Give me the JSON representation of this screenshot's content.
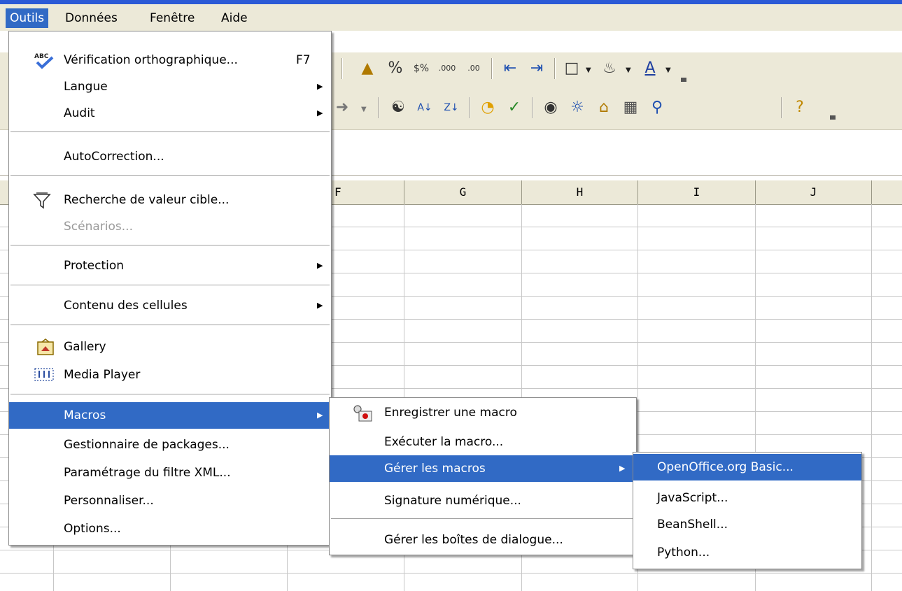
{
  "menubar": {
    "items": [
      {
        "label": "Outils",
        "active": true
      },
      {
        "label": "Données",
        "active": false
      },
      {
        "label": "Fenêtre",
        "active": false
      },
      {
        "label": "Aide",
        "active": false
      }
    ]
  },
  "columns": [
    "F",
    "G",
    "H",
    "I",
    "J"
  ],
  "outils_menu": {
    "items": [
      {
        "label": "Vérification orthographique...",
        "shortcut": "F7",
        "icon": "spellcheck-icon"
      },
      {
        "label": "Langue",
        "submenu": true
      },
      {
        "label": "Audit",
        "submenu": true
      },
      {
        "label": "AutoCorrection..."
      },
      {
        "label": "Recherche de valeur cible...",
        "icon": "goal-seek-icon"
      },
      {
        "label": "Scénarios...",
        "disabled": true
      },
      {
        "label": "Protection",
        "submenu": true
      },
      {
        "label": "Contenu des cellules",
        "submenu": true
      },
      {
        "label": "Gallery",
        "icon": "gallery-icon"
      },
      {
        "label": "Media Player",
        "icon": "media-player-icon"
      },
      {
        "label": "Macros",
        "submenu": true,
        "highlighted": true
      },
      {
        "label": "Gestionnaire de packages..."
      },
      {
        "label": "Paramétrage du filtre XML..."
      },
      {
        "label": "Personnaliser..."
      },
      {
        "label": "Options..."
      }
    ]
  },
  "macros_menu": {
    "items": [
      {
        "label": "Enregistrer une macro",
        "icon": "record-macro-icon"
      },
      {
        "label": "Exécuter la macro..."
      },
      {
        "label": "Gérer les macros",
        "submenu": true,
        "highlighted": true
      },
      {
        "label": "Signature numérique..."
      },
      {
        "label": "Gérer les boîtes de dialogue..."
      }
    ]
  },
  "gerer_menu": {
    "items": [
      {
        "label": "OpenOffice.org Basic...",
        "highlighted": true
      },
      {
        "label": "JavaScript..."
      },
      {
        "label": "BeanShell..."
      },
      {
        "label": "Python..."
      }
    ]
  },
  "toolbar": {
    "shortcut_f7": "F7"
  },
  "colors": {
    "highlight": "#316ac5",
    "menubar_bg": "#ece9d8",
    "title_strip": "#2b5ad6"
  }
}
